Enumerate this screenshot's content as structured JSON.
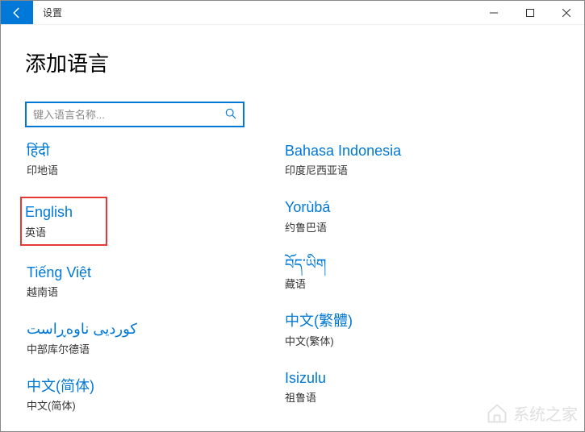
{
  "window": {
    "title": "设置"
  },
  "page": {
    "heading": "添加语言"
  },
  "search": {
    "placeholder": "键入语言名称..."
  },
  "columns": {
    "left": [
      {
        "native": "हिंदी",
        "local": "印地语",
        "highlighted": false
      },
      {
        "native": "English",
        "local": "英语",
        "highlighted": true
      },
      {
        "native": "Tiếng Việt",
        "local": "越南语",
        "highlighted": false
      },
      {
        "native": "کوردیی ناوەڕاست",
        "local": "中部库尔德语",
        "highlighted": false
      },
      {
        "native": "中文(简体)",
        "local": "中文(简体)",
        "highlighted": false
      }
    ],
    "right": [
      {
        "native": "Bahasa Indonesia",
        "local": "印度尼西亚语",
        "highlighted": false
      },
      {
        "native": "Yorùbá",
        "local": "约鲁巴语",
        "highlighted": false
      },
      {
        "native": "བོད་ཡིག",
        "local": "藏语",
        "highlighted": false
      },
      {
        "native": "中文(繁體)",
        "local": "中文(繁体)",
        "highlighted": false
      },
      {
        "native": "Isizulu",
        "local": "祖鲁语",
        "highlighted": false
      }
    ]
  },
  "watermark": "系统之家"
}
